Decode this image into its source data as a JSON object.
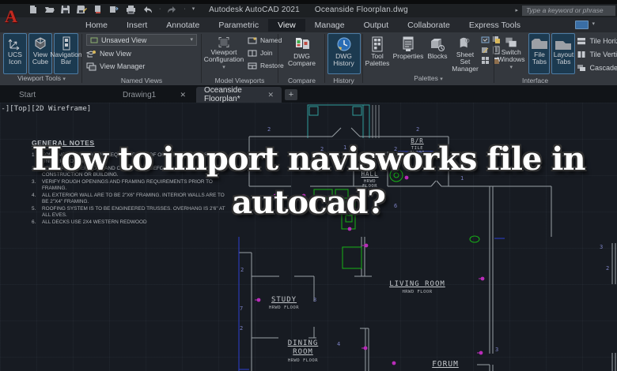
{
  "titlebar": {
    "logo": "A",
    "app_title": "Autodesk AutoCAD 2021",
    "doc_title": "Oceanside Floorplan.dwg",
    "search_placeholder": "Type a keyword or phrase",
    "qat_icons": [
      "new-file",
      "open-folder",
      "save",
      "save-as",
      "plot",
      "export",
      "print",
      "undo",
      "redo"
    ]
  },
  "glyphs": {
    "caret_down": "▾",
    "caret_right": "▸",
    "close": "✕",
    "plus": "+",
    "dot": "·"
  },
  "ribbon": {
    "tabs": [
      "Home",
      "Insert",
      "Annotate",
      "Parametric",
      "View",
      "Manage",
      "Output",
      "Collaborate",
      "Express Tools"
    ],
    "active_tab": "View",
    "panels": {
      "viewport_tools": {
        "title": "Viewport Tools",
        "buttons": [
          "UCS Icon",
          "View Cube",
          "Navigation Bar"
        ]
      },
      "named_views": {
        "title": "Named Views",
        "dropdown_value": "Unsaved View",
        "items": [
          "New View",
          "View Manager"
        ]
      },
      "model_viewports": {
        "title": "Model Viewports",
        "big_button": "Viewport Configuration",
        "small_buttons": [
          "Named",
          "Join",
          "Restore"
        ]
      },
      "compare": {
        "title": "Compare",
        "button": "DWG Compare"
      },
      "history": {
        "title": "History",
        "button": "DWG History"
      },
      "palettes": {
        "title": "Palettes",
        "buttons": [
          "Tool Palettes",
          "Properties",
          "Blocks",
          "Sheet Set Manager"
        ]
      },
      "interface": {
        "title": "Interface",
        "buttons": [
          "Switch Windows",
          "File Tabs",
          "Layout Tabs"
        ],
        "menu_items": [
          "Tile Horizontally",
          "Tile Vertically",
          "Cascade"
        ]
      }
    }
  },
  "file_tabs": {
    "tabs": [
      "Start",
      "Drawing1",
      "Oceanside Floorplan*"
    ],
    "active": "Oceanside Floorplan*",
    "new_tab_label": "+"
  },
  "viewport_label": "[-][Top][2D Wireframe]",
  "overlay": {
    "line1": "How to import navisworks file in",
    "line2": "autocad?"
  },
  "notes": {
    "title": "GENERAL NOTES",
    "items": [
      "FOUNDATION VENTILATION EQUAL TO 1 SF OF OPENING PER 150 SF OF UNDERFLOOR SPACE.",
      "VERIFY ALL DIMENSIONS AND CONDITIONS BEFORE STARTING CONSTRUCTION OR BUILDING.",
      "VERIFY ROUGH OPENINGS AND FRAMING REQUIREMENTS PRIOR TO FRAMING.",
      "ALL EXTERIOR WALL ARE TO BE 2\"X6\" FRAMING. INTERIOR WALLS ARE TO BE 2\"X4\" FRAMING.",
      "ROOFING SYSTEM IS TO BE ENGINEERED TRUSSES. OVERHANG IS 2'6\" AT ALL EVES.",
      "ALL DECKS USE 2X4 WESTERN REDWOOD"
    ],
    "numbers": [
      "1.",
      "2.",
      "3.",
      "4.",
      "5.",
      "6."
    ]
  },
  "floorplan": {
    "rooms": {
      "br": {
        "name": "B/R",
        "floor": "TILE FLOOR"
      },
      "hall": {
        "name": "HALL",
        "floor": "HRWD FLOOR"
      },
      "living": {
        "name": "LIVING ROOM",
        "floor": "HRWD FLOOR"
      },
      "study": {
        "name": "STUDY",
        "floor": "HRWD FLOOR"
      },
      "dining": {
        "name": "DINING ROOM",
        "floor": "HRWD FLOOR"
      },
      "forum": {
        "name": "FORUM",
        "floor": ""
      }
    },
    "wall_numbers": [
      "2",
      "2",
      "2",
      "1",
      "2",
      "1",
      "1",
      "6",
      "2",
      "3",
      "7",
      "2",
      "4",
      "3",
      "3",
      "2"
    ],
    "colors": {
      "wall": "#9aa0a6",
      "deck": "#2f9c9c",
      "fixture": "#17b317",
      "marker": "#b92cb9",
      "dim": "#2e3fd0"
    }
  }
}
